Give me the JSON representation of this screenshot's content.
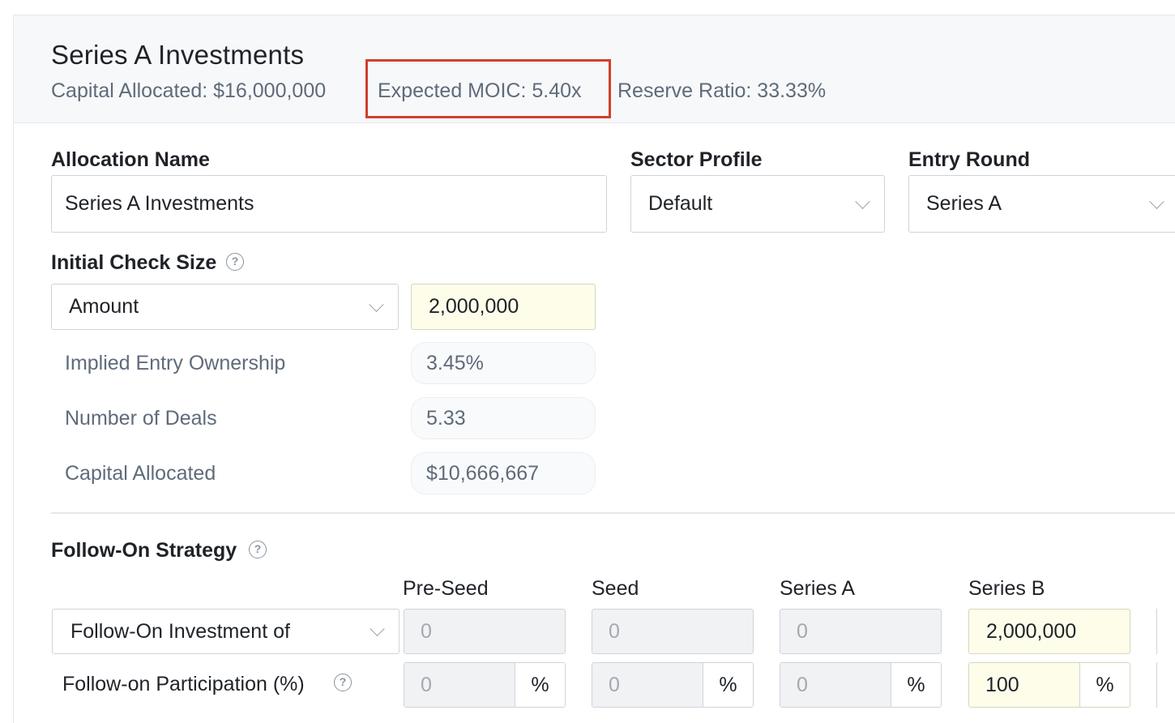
{
  "header": {
    "title": "Series A Investments",
    "capital_allocated": "Capital Allocated: $16,000,000",
    "expected_moic": "Expected MOIC: 5.40x",
    "reserve_ratio": "Reserve Ratio: 33.33%"
  },
  "form": {
    "allocation_name_label": "Allocation Name",
    "allocation_name_value": "Series A Investments",
    "sector_profile_label": "Sector Profile",
    "sector_profile_value": "Default",
    "entry_round_label": "Entry Round",
    "entry_round_value": "Series A",
    "initial_check_label": "Initial Check Size",
    "check_mode_value": "Amount",
    "check_amount_value": "2,000,000",
    "implied_ownership_label": "Implied Entry Ownership",
    "implied_ownership_value": "3.45%",
    "num_deals_label": "Number of Deals",
    "num_deals_value": "5.33",
    "capital_allocated_label": "Capital Allocated",
    "capital_allocated_value": "$10,666,667"
  },
  "follow_on": {
    "title": "Follow-On Strategy",
    "columns": [
      "Pre-Seed",
      "Seed",
      "Series A",
      "Series B"
    ],
    "mode_value": "Follow-On Investment of",
    "investment_values": [
      "0",
      "0",
      "0",
      "2,000,000"
    ],
    "participation_label": "Follow-on Participation (%)",
    "participation_values": [
      "0",
      "0",
      "0",
      "100"
    ],
    "percent_unit": "%"
  },
  "icons": {
    "help": "question-circle-icon",
    "dropdown": "chevron-down-icon"
  },
  "colors": {
    "highlight_border": "#d0402b",
    "active_input_bg": "#fefdea",
    "disabled_input_bg": "#f1f2f4"
  }
}
